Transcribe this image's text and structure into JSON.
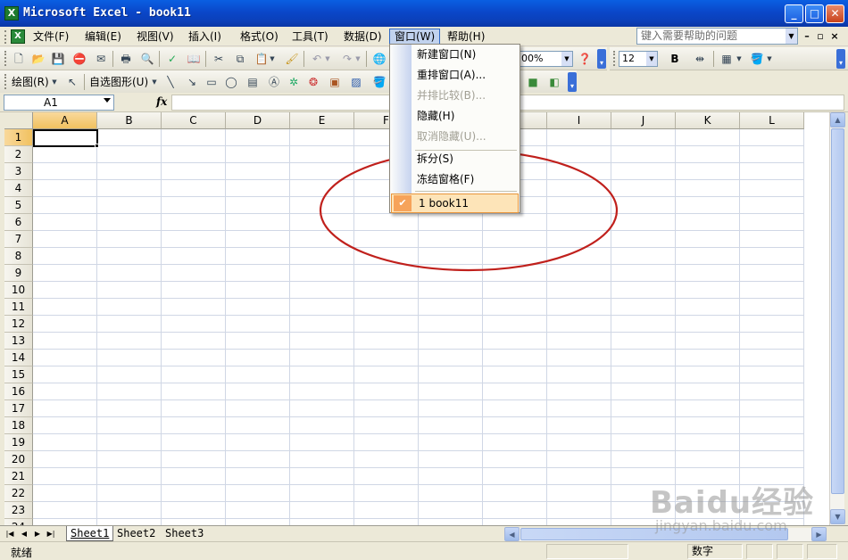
{
  "window": {
    "title": "Microsoft Excel - book11",
    "app_icon_letter": "X",
    "controls": {
      "minimize": "_",
      "maximize": "□",
      "close": "✕"
    }
  },
  "menubar": {
    "items": [
      {
        "label": "文件(F)"
      },
      {
        "label": "编辑(E)"
      },
      {
        "label": "视图(V)"
      },
      {
        "label": "插入(I)"
      },
      {
        "label": "格式(O)"
      },
      {
        "label": "工具(T)"
      },
      {
        "label": "数据(D)"
      },
      {
        "label": "窗口(W)"
      },
      {
        "label": "帮助(H)"
      }
    ],
    "help_placeholder": "键入需要帮助的问题",
    "mdi_controls": {
      "minimize": "–",
      "restore": "▫",
      "close": "×"
    }
  },
  "toolbar_standard": {
    "zoom_value": "00%",
    "font_size": "12",
    "bold_label": "B"
  },
  "toolbar_drawing": {
    "draw_label": "绘图(R)",
    "autoshapes_label": "自选图形(U)"
  },
  "formula_bar": {
    "name_box": "A1",
    "fx_label": "fx",
    "formula_value": ""
  },
  "grid": {
    "columns": [
      "A",
      "B",
      "C",
      "D",
      "E",
      "F",
      "G",
      "H",
      "I",
      "J",
      "K",
      "L"
    ],
    "rows": [
      "1",
      "2",
      "3",
      "4",
      "5",
      "6",
      "7",
      "8",
      "9",
      "10",
      "11",
      "12",
      "13",
      "14",
      "15",
      "16",
      "17",
      "18",
      "19",
      "20",
      "21",
      "22",
      "23",
      "24"
    ],
    "active_cell": "A1"
  },
  "dropdown": {
    "items": [
      {
        "label": "新建窗口(N)",
        "enabled": true
      },
      {
        "label": "重排窗口(A)...",
        "enabled": true
      },
      {
        "label": "并排比较(B)...",
        "enabled": false
      },
      {
        "label": "隐藏(H)",
        "enabled": true
      },
      {
        "label": "取消隐藏(U)...",
        "enabled": false
      },
      {
        "label": "拆分(S)",
        "enabled": true
      },
      {
        "label": "冻结窗格(F)",
        "enabled": true
      },
      {
        "label": "1 book11",
        "enabled": true,
        "checked": true
      }
    ]
  },
  "sheets": [
    "Sheet1",
    "Sheet2",
    "Sheet3"
  ],
  "status": {
    "text": "就绪",
    "num_indicator": "数字"
  },
  "watermark": {
    "logo": "Baidu经验",
    "url": "jingyan.baidu.com"
  },
  "colors": {
    "title_blue": "#0a47c9",
    "annotation_red": "#c0201c",
    "menu_highlight": "#fde4b8",
    "check_orange": "#f6a35a"
  }
}
